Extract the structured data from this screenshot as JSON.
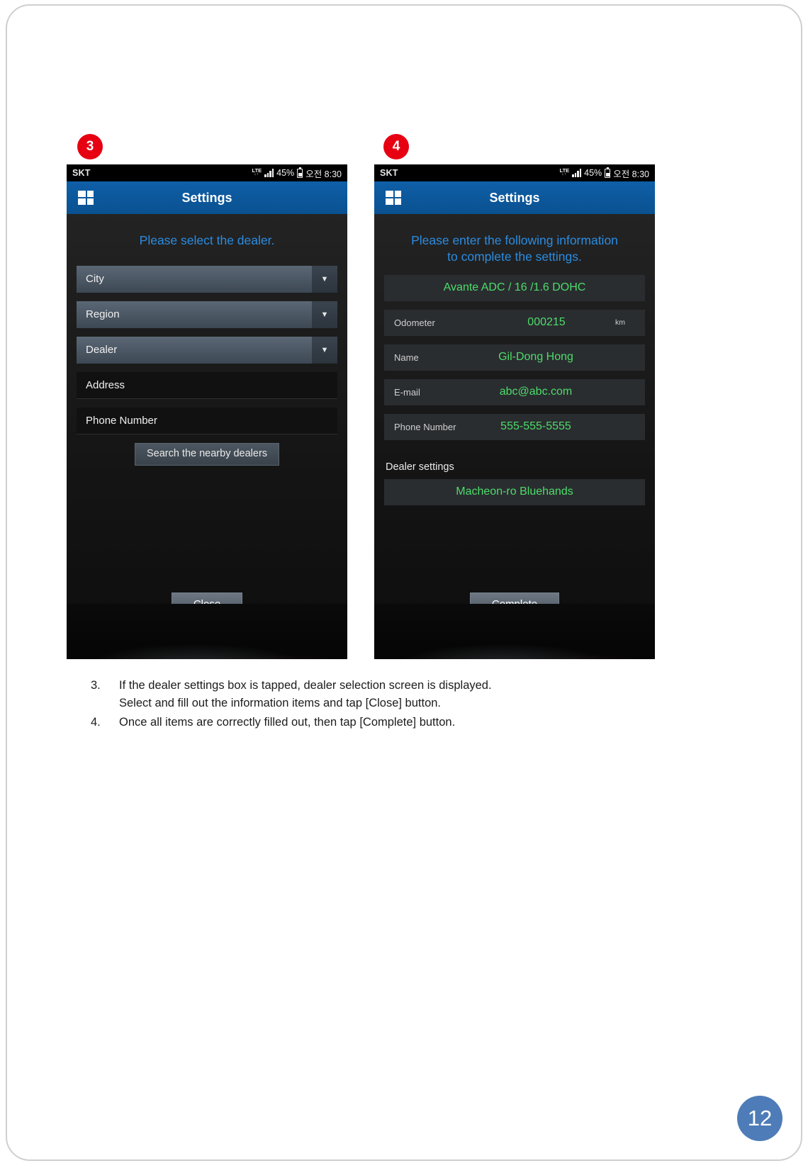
{
  "page": {
    "number": "12"
  },
  "badges": {
    "step3": "3",
    "step4": "4"
  },
  "statusbar": {
    "carrier": "SKT",
    "network": "LTE",
    "network_sub": "↓↑",
    "battery": "45%",
    "clock": "오전 8:30"
  },
  "appbar": {
    "title": "Settings",
    "menu_icon": "grid-icon"
  },
  "screen3": {
    "headline": "Please select the dealer.",
    "fields": [
      {
        "label": "City",
        "type": "select"
      },
      {
        "label": "Region",
        "type": "select"
      },
      {
        "label": "Dealer",
        "type": "select"
      },
      {
        "label": "Address",
        "type": "text"
      },
      {
        "label": "Phone Number",
        "type": "text"
      }
    ],
    "search_button": "Search the nearby dealers",
    "footer_button": "Close"
  },
  "screen4": {
    "headline_line1": "Please enter the following information",
    "headline_line2": "to complete the settings.",
    "vehicle": "Avante ADC / 16 /1.6 DOHC",
    "rows": [
      {
        "label": "Odometer",
        "value": "000215",
        "unit": "km"
      },
      {
        "label": "Name",
        "value": "Gil-Dong Hong",
        "unit": ""
      },
      {
        "label": "E-mail",
        "value": "abc@abc.com",
        "unit": ""
      },
      {
        "label": "Phone Number",
        "value": "555-555-5555",
        "unit": ""
      }
    ],
    "dealer_section_label": "Dealer settings",
    "dealer_value": "Macheon-ro Bluehands",
    "footer_button": "Complete"
  },
  "instructions": [
    {
      "num": "3.",
      "lines": [
        "If the dealer settings box is tapped, dealer selection screen is displayed.",
        "Select and fill out the information items and tap [Close] button."
      ]
    },
    {
      "num": "4.",
      "lines": [
        "Once all items are correctly filled out, then tap [Complete] button."
      ]
    }
  ],
  "colors": {
    "accent_blue": "#2b8ce0",
    "appbar_blue": "#0b5394",
    "value_green": "#4ddc6a",
    "badge_red": "#e60012",
    "page_num_blue": "#4e7cb8"
  }
}
